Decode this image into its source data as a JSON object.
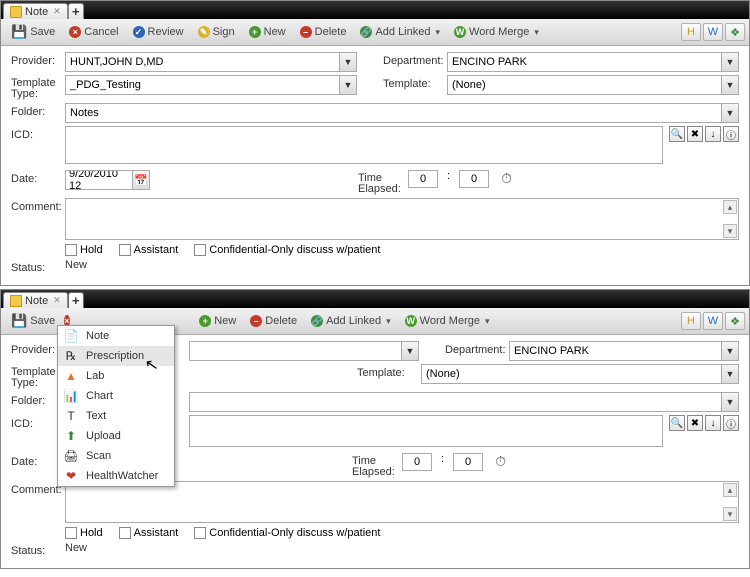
{
  "tabs": {
    "note_label": "Note",
    "add_label": "+"
  },
  "toolbar": {
    "save": "Save",
    "cancel": "Cancel",
    "review": "Review",
    "sign": "Sign",
    "new": "New",
    "delete": "Delete",
    "addlinked": "Add Linked",
    "wordmerge": "Word Merge"
  },
  "labels": {
    "provider": "Provider:",
    "template_type": "Template\nType:",
    "folder": "Folder:",
    "icd": "ICD:",
    "date": "Date:",
    "time_elapsed": "Time\nElapsed:",
    "comment": "Comment:",
    "status": "Status:",
    "department": "Department:",
    "template": "Template:"
  },
  "values": {
    "provider": "HUNT,JOHN D,MD",
    "template_type": "_PDG_Testing",
    "folder": "Notes",
    "department": "ENCINO PARK",
    "template": "(None)",
    "date": "9/20/2010 12",
    "time_h": "0",
    "time_m": "0",
    "time_sep": ":",
    "status": "New"
  },
  "checks": {
    "hold": "Hold",
    "assistant": "Assistant",
    "confidential": "Confidential-Only discuss w/patient"
  },
  "right_icons": {
    "a": "H",
    "b": "W",
    "c": "❖"
  },
  "icd_icons": {
    "a": "🔍",
    "b": "✖",
    "c": "↓",
    "d": "ⓘ"
  },
  "menu": {
    "note": "Note",
    "prescription": "Prescription",
    "lab": "Lab",
    "chart": "Chart",
    "text": "Text",
    "upload": "Upload",
    "scan": "Scan",
    "healthwatcher": "HealthWatcher"
  }
}
